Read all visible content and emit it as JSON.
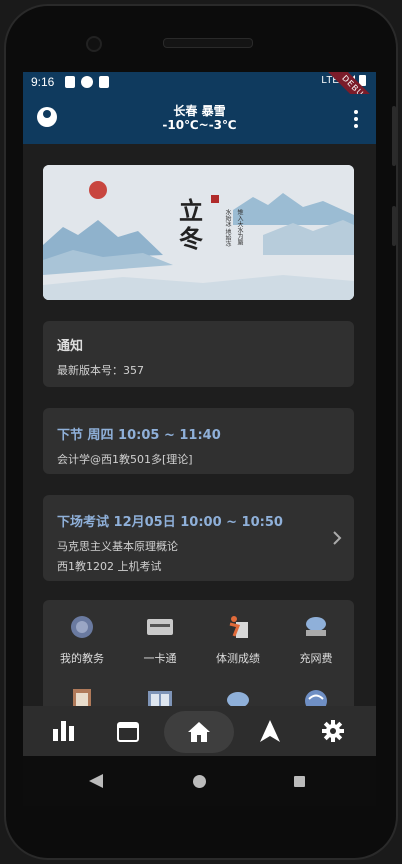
{
  "status_bar": {
    "time": "9:16",
    "network": "LTE",
    "debug_banner": "DEBUG"
  },
  "app_bar": {
    "location_weather": "长春 暴雪",
    "temperature": "-10℃~-3℃"
  },
  "banner": {
    "title_char_1": "立",
    "title_char_2": "冬",
    "poem_line_1": "水始冰 地始冻",
    "poem_line_2": "雉入大水为蜃"
  },
  "notice_card": {
    "title": "通知",
    "version_text": "最新版本号：357"
  },
  "next_class_card": {
    "title": "下节 周四 10:05 ~ 11:40",
    "detail": "会计学@西1教501多[理论]"
  },
  "next_exam_card": {
    "title": "下场考试 12月05日 10:00 ~ 10:50",
    "course": "马克思主义基本原理概论",
    "location": "西1教1202  上机考试"
  },
  "quick_links": [
    {
      "label": "我的教务",
      "icon": "academic-seal-icon"
    },
    {
      "label": "一卡通",
      "icon": "campus-card-icon"
    },
    {
      "label": "体测成绩",
      "icon": "fitness-test-icon"
    },
    {
      "label": "充网费",
      "icon": "network-fee-icon"
    },
    {
      "label": "",
      "icon": "clipboard-icon"
    },
    {
      "label": "",
      "icon": "book-icon"
    },
    {
      "label": "",
      "icon": "cloud-icon"
    },
    {
      "label": "",
      "icon": "wifi-icon"
    }
  ],
  "bottom_nav": [
    {
      "name": "statistics",
      "icon": "bar-chart-icon"
    },
    {
      "name": "calendar",
      "icon": "calendar-icon"
    },
    {
      "name": "home",
      "icon": "home-icon",
      "active": true
    },
    {
      "name": "navigation",
      "icon": "navigation-icon"
    },
    {
      "name": "settings",
      "icon": "gear-icon"
    }
  ],
  "colors": {
    "app_bar": "#0f3a5e",
    "background": "#1e1e1e",
    "card": "#303030",
    "accent_text": "#8fb0d9"
  }
}
